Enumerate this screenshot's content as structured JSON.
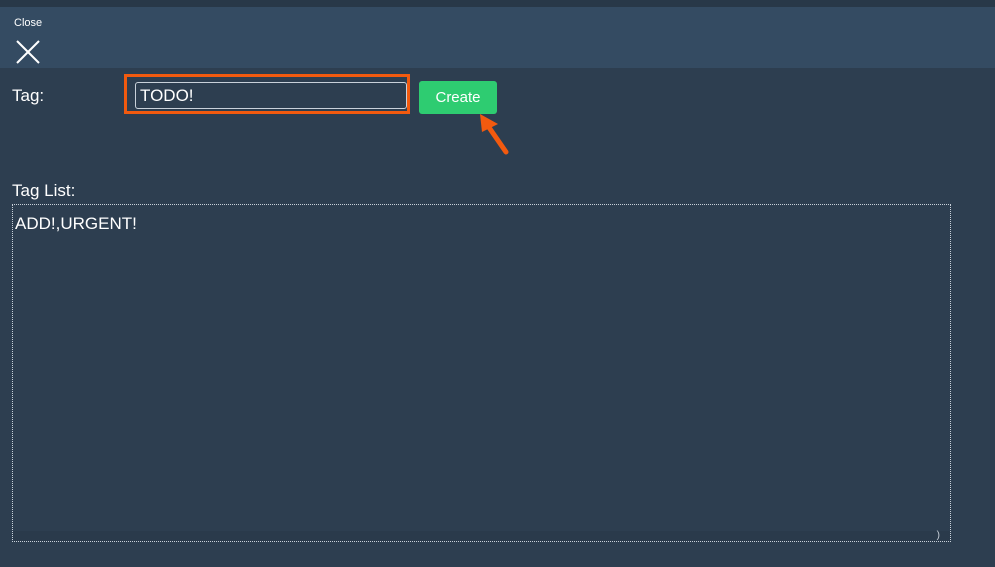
{
  "header": {
    "close_label": "Close",
    "close_icon": "close-icon"
  },
  "form": {
    "tag_label": "Tag:",
    "tag_value": "TODO!",
    "create_label": "Create"
  },
  "tag_list": {
    "label": "Tag List:",
    "content": "ADD!,URGENT!"
  },
  "colors": {
    "background": "#2d3e50",
    "header": "#344b62",
    "create_button": "#2ecc71",
    "highlight": "#f25a0f"
  }
}
